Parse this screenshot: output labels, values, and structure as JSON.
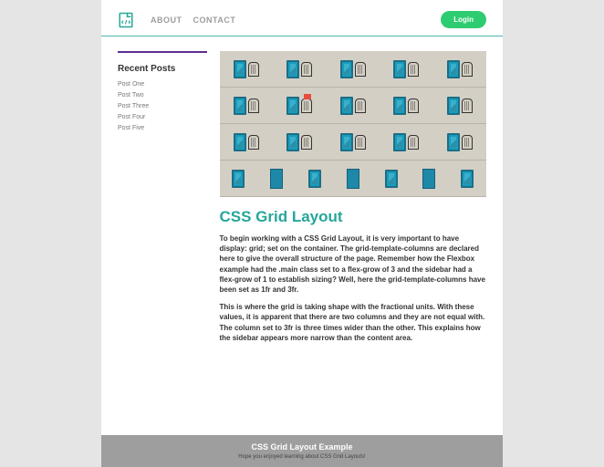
{
  "nav": {
    "items": [
      "ABOUT",
      "CONTACT"
    ],
    "login": "Login"
  },
  "sidebar": {
    "heading": "Recent Posts",
    "items": [
      "Post One",
      "Post Two",
      "Post Three",
      "Post Four",
      "Post Five"
    ]
  },
  "article": {
    "title": "CSS Grid Layout",
    "p1": "To begin working with a CSS Grid Layout, it is very important to have display: grid; set on the container. The grid-template-columns are declared here to give the overall structure of the page. Remember how the Flexbox example had the .main class set to a flex-grow of 3 and the sidebar had a flex-grow of 1 to establish sizing? Well, here the grid-template-columns have been set as 1fr and 3fr.",
    "p2": "This is where the grid is taking shape with the fractional units. With these values, it is apparent that there are two columns and they are not equal with. The column set to 3fr is three times wider than the other. This explains how the sidebar appears more narrow than the content area."
  },
  "footer": {
    "title": "CSS Grid Layout Example",
    "sub": "Hope you enjoyed learning about CSS Grid Layouts!"
  }
}
